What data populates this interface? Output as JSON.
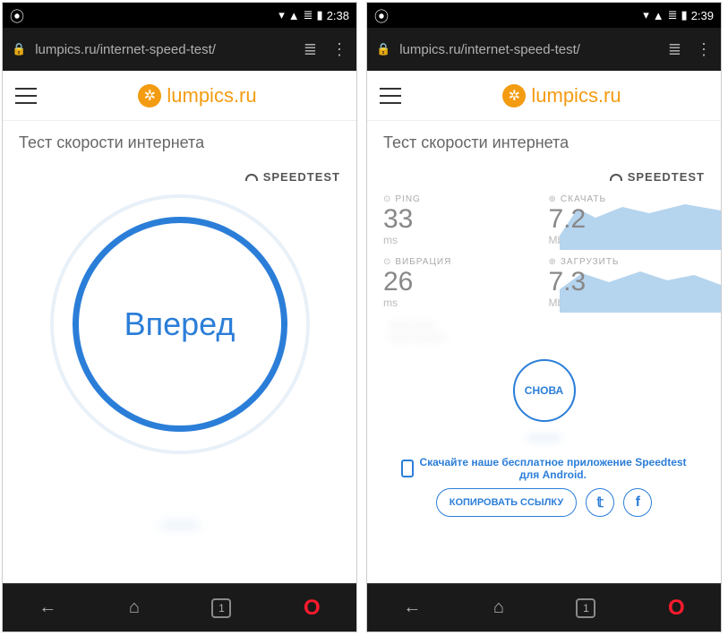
{
  "left": {
    "status": {
      "time": "2:38"
    },
    "url": "lumpics.ru/internet-speed-test/",
    "logo_text": "lumpics.ru",
    "page_title": "Тест скорости интернета",
    "speedtest_label": "SPEEDTEST",
    "go_label": "Вперед",
    "blur_text": "———",
    "bottom": {
      "tabcount": "1"
    }
  },
  "right": {
    "status": {
      "time": "2:39"
    },
    "url": "lumpics.ru/internet-speed-test/",
    "logo_text": "lumpics.ru",
    "page_title": "Тест скорости интернета",
    "speedtest_label": "SPEEDTEST",
    "results": {
      "ping": {
        "label": "PING",
        "value": "33",
        "unit": "ms"
      },
      "jitter": {
        "label": "ВИБРАЦИЯ",
        "value": "26",
        "unit": "ms"
      },
      "download": {
        "label": "СКАЧАТЬ",
        "value": "7.2",
        "unit": "Mbps"
      },
      "upload": {
        "label": "ЗАГРУЗИТЬ",
        "value": "7.3",
        "unit": "Mbps"
      }
    },
    "again_label": "СНОВА",
    "promo_text": "Скачайте наше бесплатное приложение Speedtest для Android.",
    "copy_label": "КОПИРОВАТЬ ССЫЛКУ",
    "bottom": {
      "tabcount": "1"
    }
  }
}
